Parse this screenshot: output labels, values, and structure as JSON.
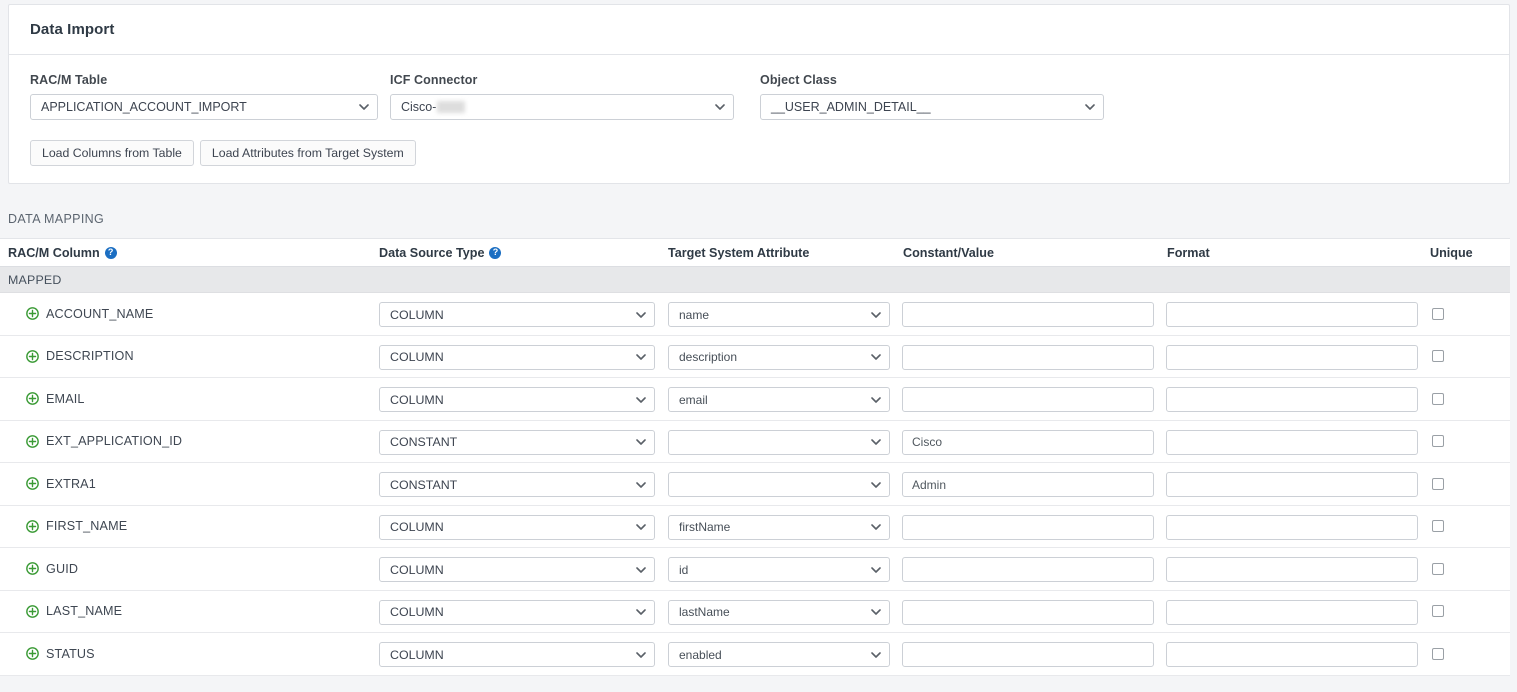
{
  "card": {
    "title": "Data Import",
    "fields": [
      {
        "label": "RAC/M Table",
        "value": "APPLICATION_ACCOUNT_IMPORT",
        "redacted": false
      },
      {
        "label": "ICF Connector",
        "value": "Cisco-",
        "redacted": true
      },
      {
        "label": "Object Class",
        "value": "__USER_ADMIN_DETAIL__",
        "redacted": false
      }
    ],
    "buttons": [
      {
        "label": "Load Columns from Table"
      },
      {
        "label": "Load Attributes from Target System"
      }
    ]
  },
  "data_mapping": {
    "section_title": "DATA MAPPING",
    "group_label": "MAPPED",
    "columns": [
      {
        "label": "RAC/M Column",
        "help": true
      },
      {
        "label": "Data Source Type",
        "help": true
      },
      {
        "label": "Target System Attribute",
        "help": false
      },
      {
        "label": "Constant/Value",
        "help": false
      },
      {
        "label": "Format",
        "help": false
      },
      {
        "label": "Unique",
        "help": false
      }
    ],
    "rows": [
      {
        "name": "ACCOUNT_NAME",
        "source_type": "COLUMN",
        "target_attr": "name",
        "constant": "",
        "format": "",
        "unique": false
      },
      {
        "name": "DESCRIPTION",
        "source_type": "COLUMN",
        "target_attr": "description",
        "constant": "",
        "format": "",
        "unique": false
      },
      {
        "name": "EMAIL",
        "source_type": "COLUMN",
        "target_attr": "email",
        "constant": "",
        "format": "",
        "unique": false
      },
      {
        "name": "EXT_APPLICATION_ID",
        "source_type": "CONSTANT",
        "target_attr": "",
        "constant": "Cisco",
        "format": "",
        "unique": false
      },
      {
        "name": "EXTRA1",
        "source_type": "CONSTANT",
        "target_attr": "",
        "constant": "Admin",
        "format": "",
        "unique": false
      },
      {
        "name": "FIRST_NAME",
        "source_type": "COLUMN",
        "target_attr": "firstName",
        "constant": "",
        "format": "",
        "unique": false
      },
      {
        "name": "GUID",
        "source_type": "COLUMN",
        "target_attr": "id",
        "constant": "",
        "format": "",
        "unique": false
      },
      {
        "name": "LAST_NAME",
        "source_type": "COLUMN",
        "target_attr": "lastName",
        "constant": "",
        "format": "",
        "unique": false
      },
      {
        "name": "STATUS",
        "source_type": "COLUMN",
        "target_attr": "enabled",
        "constant": "",
        "format": "",
        "unique": false
      }
    ]
  },
  "colors": {
    "accent_blue": "#1b6ec2",
    "plus_green": "#3a9a35",
    "page_bg": "#f4f5f7",
    "group_bg": "#e7e8ea"
  },
  "icons": {
    "help": "?",
    "chevron_down": "chevron-down-icon",
    "plus_circle": "plus-circle-icon"
  }
}
